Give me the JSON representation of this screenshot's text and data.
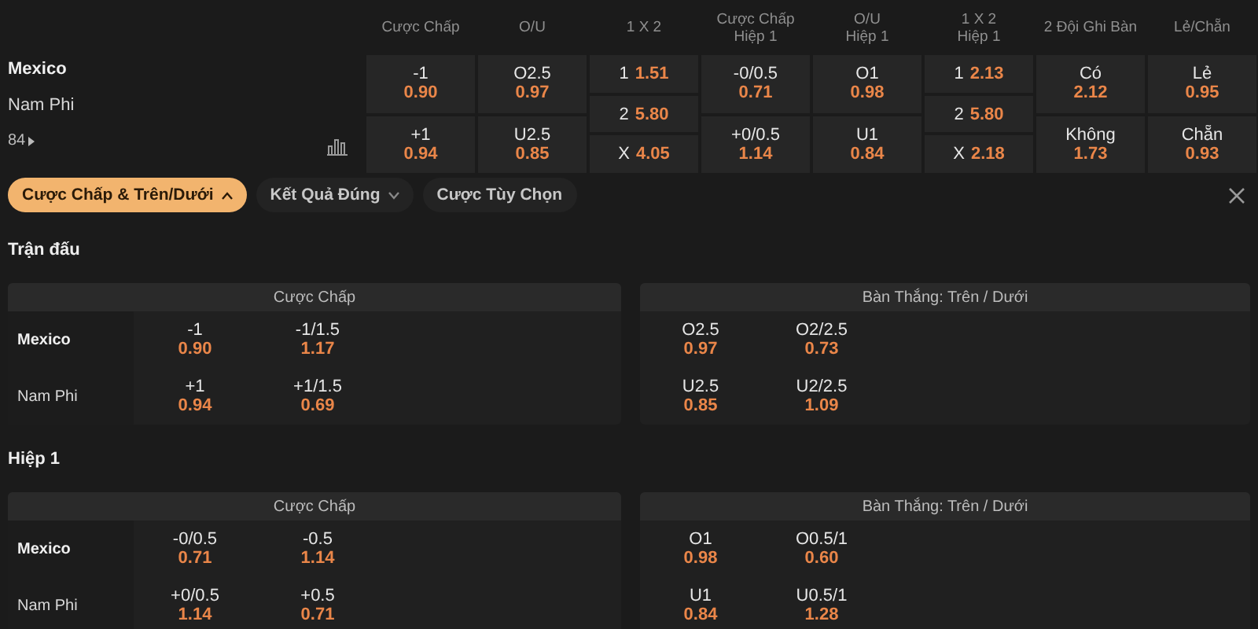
{
  "match": {
    "teams": [
      {
        "name": "Mexico",
        "bold": true
      },
      {
        "name": "Nam Phi",
        "bold": false
      }
    ],
    "more_count": "84"
  },
  "markets": [
    {
      "header": [
        "Cược Chấp"
      ],
      "kind": "pair",
      "cells": [
        {
          "label": "-1",
          "odds": "0.90"
        },
        {
          "label": "+1",
          "odds": "0.94"
        }
      ]
    },
    {
      "header": [
        "O/U"
      ],
      "kind": "pair",
      "cells": [
        {
          "label": "O2.5",
          "odds": "0.97"
        },
        {
          "label": "U2.5",
          "odds": "0.85"
        }
      ]
    },
    {
      "header": [
        "1 X 2"
      ],
      "kind": "triple",
      "cells": [
        {
          "label": "1",
          "odds": "1.51"
        },
        {
          "label": "2",
          "odds": "5.80"
        },
        {
          "label": "X",
          "odds": "4.05"
        }
      ]
    },
    {
      "header": [
        "Cược Chấp",
        "Hiệp 1"
      ],
      "kind": "pair",
      "cells": [
        {
          "label": "-0/0.5",
          "odds": "0.71"
        },
        {
          "label": "+0/0.5",
          "odds": "1.14"
        }
      ]
    },
    {
      "header": [
        "O/U",
        "Hiệp 1"
      ],
      "kind": "pair",
      "cells": [
        {
          "label": "O1",
          "odds": "0.98"
        },
        {
          "label": "U1",
          "odds": "0.84"
        }
      ]
    },
    {
      "header": [
        "1 X 2",
        "Hiệp 1"
      ],
      "kind": "triple",
      "cells": [
        {
          "label": "1",
          "odds": "2.13"
        },
        {
          "label": "2",
          "odds": "5.80"
        },
        {
          "label": "X",
          "odds": "2.18"
        }
      ]
    },
    {
      "header": [
        "2 Đội Ghi Bàn"
      ],
      "kind": "pair",
      "cells": [
        {
          "label": "Có",
          "odds": "2.12"
        },
        {
          "label": "Không",
          "odds": "1.73"
        }
      ]
    },
    {
      "header": [
        "Lẻ/Chẵn"
      ],
      "kind": "pair",
      "cells": [
        {
          "label": "Lẻ",
          "odds": "0.95"
        },
        {
          "label": "Chẵn",
          "odds": "0.93"
        }
      ]
    }
  ],
  "tabs": [
    {
      "label": "Cược Chấp & Trên/Dưới",
      "selected": true,
      "kind": "expanded"
    },
    {
      "label": "Kết Quả Đúng",
      "selected": false,
      "kind": "collapsed"
    },
    {
      "label": "Cược Tùy Chọn",
      "selected": false,
      "kind": "plain"
    }
  ],
  "sections": [
    {
      "title": "Trận đấu",
      "panels": [
        {
          "title": "Cược Chấp",
          "rows": [
            {
              "team": {
                "name": "Mexico",
                "bold": true
              },
              "odds": [
                {
                  "label": "-1",
                  "odds": "0.90"
                },
                {
                  "label": "-1/1.5",
                  "odds": "1.17"
                }
              ]
            },
            {
              "team": {
                "name": "Nam Phi",
                "bold": false
              },
              "odds": [
                {
                  "label": "+1",
                  "odds": "0.94"
                },
                {
                  "label": "+1/1.5",
                  "odds": "0.69"
                }
              ]
            }
          ]
        },
        {
          "title": "Bàn Thắng: Trên / Dưới",
          "rows": [
            {
              "odds": [
                {
                  "label": "O2.5",
                  "odds": "0.97"
                },
                {
                  "label": "O2/2.5",
                  "odds": "0.73"
                }
              ]
            },
            {
              "odds": [
                {
                  "label": "U2.5",
                  "odds": "0.85"
                },
                {
                  "label": "U2/2.5",
                  "odds": "1.09"
                }
              ]
            }
          ]
        }
      ]
    },
    {
      "title": "Hiệp 1",
      "panels": [
        {
          "title": "Cược Chấp",
          "rows": [
            {
              "team": {
                "name": "Mexico",
                "bold": true
              },
              "odds": [
                {
                  "label": "-0/0.5",
                  "odds": "0.71"
                },
                {
                  "label": "-0.5",
                  "odds": "1.14"
                }
              ]
            },
            {
              "team": {
                "name": "Nam Phi",
                "bold": false
              },
              "odds": [
                {
                  "label": "+0/0.5",
                  "odds": "1.14"
                },
                {
                  "label": "+0.5",
                  "odds": "0.71"
                }
              ]
            }
          ]
        },
        {
          "title": "Bàn Thắng: Trên / Dưới",
          "rows": [
            {
              "odds": [
                {
                  "label": "O1",
                  "odds": "0.98"
                },
                {
                  "label": "O0.5/1",
                  "odds": "0.60"
                }
              ]
            },
            {
              "odds": [
                {
                  "label": "U1",
                  "odds": "0.84"
                },
                {
                  "label": "U0.5/1",
                  "odds": "1.28"
                }
              ]
            }
          ]
        }
      ]
    }
  ]
}
